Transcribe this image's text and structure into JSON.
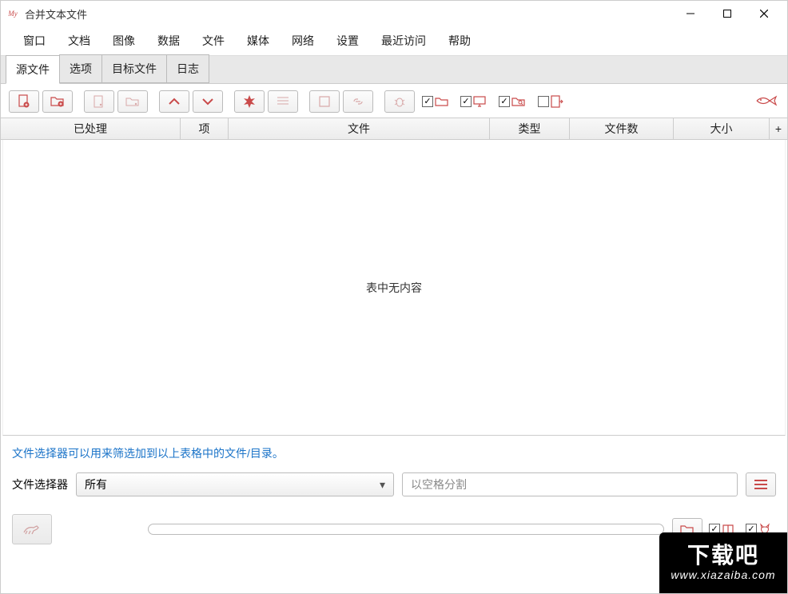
{
  "app": {
    "title": "合并文本文件"
  },
  "menu": {
    "window": "窗口",
    "document": "文档",
    "image": "图像",
    "data": "数据",
    "file": "文件",
    "media": "媒体",
    "network": "网络",
    "settings": "设置",
    "recent": "最近访问",
    "help": "帮助"
  },
  "tabs": {
    "source": "源文件",
    "options": "选项",
    "target": "目标文件",
    "log": "日志"
  },
  "grid": {
    "headers": {
      "processed": "已处理",
      "item": "项",
      "file": "文件",
      "type": "类型",
      "count": "文件数",
      "size": "大小",
      "add": "+"
    },
    "empty": "表中无内容"
  },
  "filter": {
    "help": "文件选择器可以用来筛选加到以上表格中的文件/目录。",
    "label": "文件选择器",
    "select_value": "所有",
    "placeholder": "以空格分割"
  },
  "watermark": {
    "title": "下载吧",
    "url": "www.xiazaiba.com"
  }
}
